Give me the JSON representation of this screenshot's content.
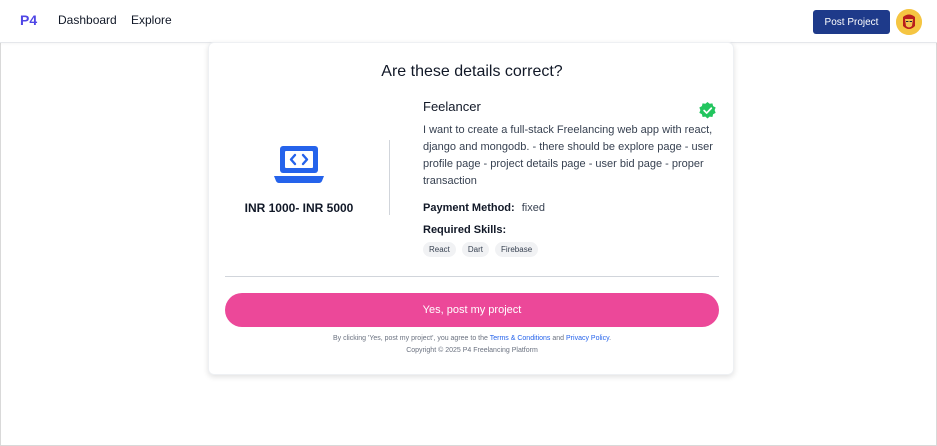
{
  "nav": {
    "logo": "P4",
    "links": [
      "Dashboard",
      "Explore"
    ],
    "post_button": "Post Project",
    "avatar_icon": "ironman-avatar-icon"
  },
  "card": {
    "title": "Are these details correct?",
    "budget": "INR 1000- INR 5000",
    "laptop_icon": "laptop-code-icon",
    "project": {
      "title": "Feelancer",
      "verified_icon": "verified-check-icon",
      "description": "I want to create a full-stack Freelancing web app with react, django and mongodb. - there should be explore page - user profile page - project details page - user bid page - proper transaction",
      "payment_label": "Payment Method:",
      "payment_value": "fixed",
      "skills_label": "Required Skills:",
      "skills": [
        "React",
        "Dart",
        "Firebase"
      ]
    },
    "cta": "Yes, post my project",
    "legal": {
      "prefix": "By clicking 'Yes, post my project', you agree to the ",
      "terms": "Terms & Conditions",
      "and": " and ",
      "privacy": "Privacy Policy",
      "suffix": ".",
      "copyright": "Copyright © 2025 P4 Freelancing Platform"
    }
  },
  "colors": {
    "accent": "#ec4899",
    "primary": "#1e3a8a",
    "logo": "#4f46e5",
    "verified": "#22c55e",
    "icon": "#2563eb"
  }
}
